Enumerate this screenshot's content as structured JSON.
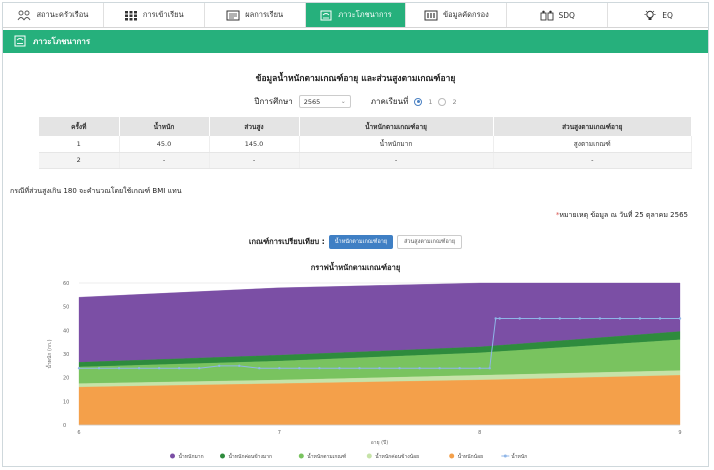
{
  "tabs": [
    {
      "label": "สถานะครัวเรือน",
      "icon": "family-icon",
      "active": false
    },
    {
      "label": "การเข้าเรียน",
      "icon": "attendance-grid-icon",
      "active": false
    },
    {
      "label": "ผลการเรียน",
      "icon": "report-icon",
      "active": false
    },
    {
      "label": "ภาวะโภชนาการ",
      "icon": "nutrition-icon",
      "active": true
    },
    {
      "label": "ข้อมูลคัดกรอง",
      "icon": "screening-icon",
      "active": false
    },
    {
      "label": "SDQ",
      "icon": "sdq-people-icon",
      "active": false
    },
    {
      "label": "EQ",
      "icon": "lightbulb-icon",
      "active": false
    }
  ],
  "section_title": "ภาวะโภชนาการ",
  "heading": "ข้อมูลน้ำหนักตามเกณฑ์อายุ และส่วนสูงตามเกณฑ์อายุ",
  "filters": {
    "year_label": "ปีการศึกษา",
    "year_value": "2565",
    "term_label": "ภาคเรียนที่",
    "term_options": [
      "1",
      "2"
    ],
    "term_selected": "1"
  },
  "table": {
    "headers": [
      "ครั้งที่",
      "น้ำหนัก",
      "ส่วนสูง",
      "น้ำหนักตามเกณฑ์อายุ",
      "ส่วนสูงตามเกณฑ์อายุ"
    ],
    "rows": [
      [
        "1",
        "45.0",
        "145.0",
        "น้ำหนักมาก",
        "สูงตามเกณฑ์"
      ],
      [
        "2",
        "-",
        "-",
        "-",
        "-"
      ]
    ]
  },
  "note": "กรณีที่ส่วนสูงเกิน 180 จะคำนวณโดยใช้เกณฑ์ BMI แทน",
  "remark_star": "*",
  "remark": "หมายเหตุ ข้อมูล ณ วันที่ 25 ตุลาคม 2565",
  "compare": {
    "label": "เกณฑ์การเปรียบเทียบ :",
    "option_primary": "น้ำหนักตามเกณฑ์อายุ",
    "option_secondary": "ส่วนสูงตามเกณฑ์อายุ"
  },
  "chart_title": "กราฟน้ำหนักตามเกณฑ์อายุ",
  "chart_data": {
    "type": "area",
    "title": "กราฟน้ำหนักตามเกณฑ์อายุ",
    "xlabel": "อายุ (ปี)",
    "ylabel": "น้ำหนัก (กก.)",
    "xlim": [
      6,
      9
    ],
    "ylim": [
      0,
      60
    ],
    "x_ticks": [
      6,
      7,
      8,
      9
    ],
    "y_ticks": [
      0,
      10,
      20,
      30,
      40,
      50,
      60
    ],
    "grid": true,
    "legend_position": "bottom",
    "bands": [
      {
        "name": "น้ำหนักมาก",
        "color": "#7b4fa5",
        "lower": [
          [
            6,
            26.5
          ],
          [
            7,
            29.5
          ],
          [
            8,
            33
          ],
          [
            9,
            39.5
          ]
        ],
        "upper": [
          [
            6,
            54
          ],
          [
            7,
            58
          ],
          [
            8,
            60
          ],
          [
            9,
            60
          ]
        ]
      },
      {
        "name": "น้ำหนักค่อนข้างมาก",
        "color": "#2e8b3d",
        "lower": [
          [
            6,
            24.5
          ],
          [
            7,
            27
          ],
          [
            8,
            30.5
          ],
          [
            9,
            36
          ]
        ],
        "upper": [
          [
            6,
            26.5
          ],
          [
            7,
            29.5
          ],
          [
            8,
            33
          ],
          [
            9,
            39.5
          ]
        ]
      },
      {
        "name": "น้ำหนักตามเกณฑ์",
        "color": "#79c35f",
        "lower": [
          [
            6,
            17.5
          ],
          [
            7,
            19
          ],
          [
            8,
            21
          ],
          [
            9,
            23
          ]
        ],
        "upper": [
          [
            6,
            24.5
          ],
          [
            7,
            27
          ],
          [
            8,
            30.5
          ],
          [
            9,
            36
          ]
        ]
      },
      {
        "name": "น้ำหนักค่อนข้างน้อย",
        "color": "#c6e3a8",
        "lower": [
          [
            6,
            16
          ],
          [
            7,
            17.5
          ],
          [
            8,
            19
          ],
          [
            9,
            21
          ]
        ],
        "upper": [
          [
            6,
            17.5
          ],
          [
            7,
            19
          ],
          [
            8,
            21
          ],
          [
            9,
            23
          ]
        ]
      },
      {
        "name": "น้ำหนักน้อย",
        "color": "#f4a04a",
        "lower": [
          [
            6,
            0
          ],
          [
            7,
            0
          ],
          [
            8,
            0
          ],
          [
            9,
            0
          ]
        ],
        "upper": [
          [
            6,
            16
          ],
          [
            7,
            17.5
          ],
          [
            8,
            19
          ],
          [
            9,
            21
          ]
        ]
      }
    ],
    "series": [
      {
        "name": "น้ำหนัก",
        "color": "#8fb6e8",
        "x": [
          6,
          6.1,
          6.2,
          6.3,
          6.4,
          6.5,
          6.6,
          6.7,
          6.8,
          6.9,
          7,
          7.1,
          7.2,
          7.3,
          7.4,
          7.5,
          7.6,
          7.7,
          7.8,
          7.9,
          8,
          8.05,
          8.08,
          8.1,
          8.2,
          8.3,
          8.4,
          8.5,
          8.6,
          8.7,
          8.8,
          8.9,
          9
        ],
        "values": [
          24,
          24,
          24,
          24,
          24,
          24,
          24,
          25,
          25,
          24,
          24,
          24,
          24,
          24,
          24,
          24,
          24,
          24,
          24,
          24,
          24,
          24,
          45,
          45,
          45,
          45,
          45,
          45,
          45,
          45,
          45,
          45,
          45
        ]
      }
    ]
  }
}
